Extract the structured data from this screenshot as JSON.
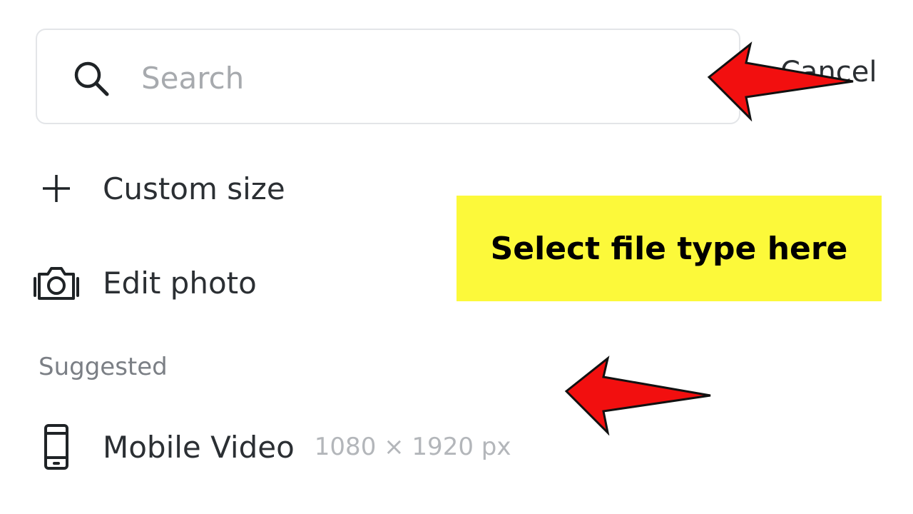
{
  "search": {
    "placeholder": "Search",
    "value": "",
    "cancel_label": "Cancel"
  },
  "menu": {
    "custom_size_label": "Custom size",
    "edit_photo_label": "Edit photo"
  },
  "suggested": {
    "heading": "Suggested",
    "items": [
      {
        "label": "Mobile Video",
        "dimensions": "1080 × 1920 px",
        "icon": "mobile-phone-icon"
      }
    ]
  },
  "annotation": {
    "callout_text": "Select file type here",
    "callout_color": "#fcf93a",
    "arrow_color": "#f20f0f"
  },
  "icons": [
    "search-icon",
    "plus-icon",
    "camera-icon",
    "mobile-phone-icon"
  ]
}
